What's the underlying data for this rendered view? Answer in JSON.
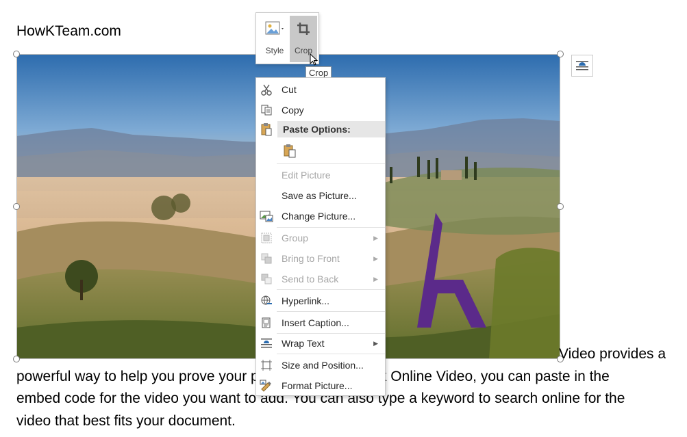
{
  "document": {
    "title": "HowKTeam.com",
    "paragraph_lines": [
      "Video provides a",
      "powerful way to help you prove your point. When you click Online Video, you can paste in the",
      "embed code for the video you want to add. You can also type a keyword to search online for the",
      "video that best fits your document."
    ]
  },
  "mini_toolbar": {
    "style_label": "Style",
    "crop_label": "Crop",
    "style_icon": "picture-style-icon",
    "crop_icon": "crop-icon"
  },
  "tooltip": {
    "text": "Crop"
  },
  "context_menu": {
    "cut": "Cut",
    "copy": "Copy",
    "paste_options": "Paste Options:",
    "edit_picture": "Edit Picture",
    "save_as_picture": "Save as Picture...",
    "change_picture": "Change Picture...",
    "group": "Group",
    "bring_to_front": "Bring to Front",
    "send_to_back": "Send to Back",
    "hyperlink": "Hyperlink...",
    "insert_caption": "Insert Caption...",
    "wrap_text": "Wrap Text",
    "size_and_position": "Size and Position...",
    "format_picture": "Format Picture..."
  },
  "colors": {
    "logo_purple": "#5b2a8a",
    "menu_highlight": "#e6e6e6",
    "crop_button_bg": "#c8c8c8"
  }
}
